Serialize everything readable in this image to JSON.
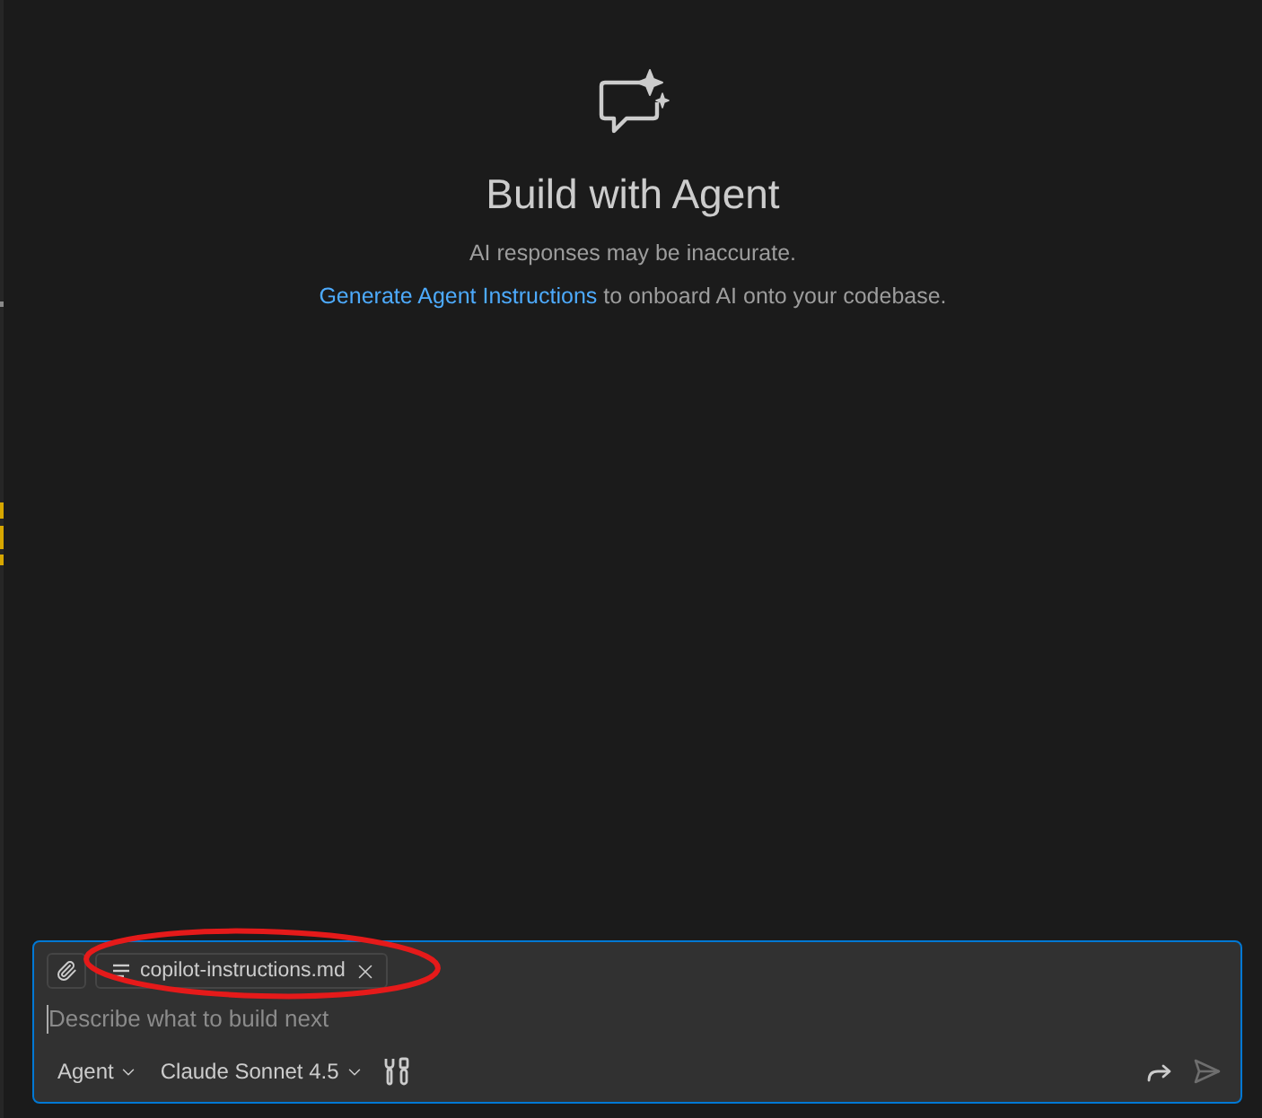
{
  "welcome": {
    "title": "Build with Agent",
    "disclaimer": "AI responses may be inaccurate.",
    "instructions": {
      "link": "Generate Agent Instructions",
      "text": "to onboard AI onto your codebase."
    }
  },
  "chat_input": {
    "attachments": [
      {
        "name": "copilot-instructions.md"
      }
    ],
    "placeholder": "Describe what to build next",
    "mode": "Agent",
    "model": "Claude Sonnet 4.5"
  }
}
